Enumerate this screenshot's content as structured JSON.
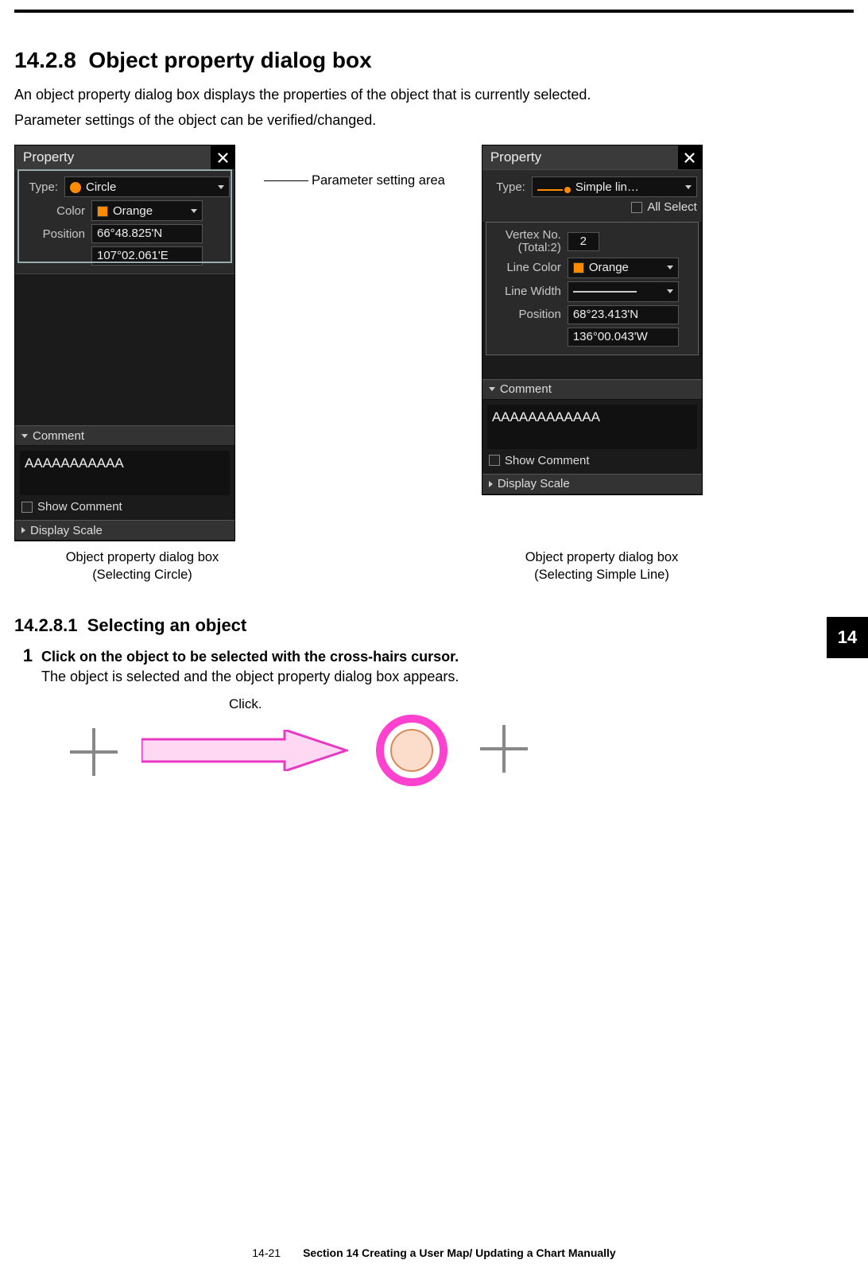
{
  "section": {
    "num": "14.2.8",
    "title": "Object property dialog box",
    "intro1": "An object property dialog box displays the properties of the object that is currently selected.",
    "intro2": "Parameter settings of the object can be verified/changed."
  },
  "callout": {
    "text": "Parameter setting area"
  },
  "dialogA": {
    "title": "Property",
    "typeLabel": "Type:",
    "typeValue": "Circle",
    "colorLabel": "Color",
    "colorValue": "Orange",
    "posLabel": "Position",
    "pos1": "66°48.825'N",
    "pos2": "107°02.061'E",
    "commentHeader": "Comment",
    "commentText": "AAAAAAAAAAA",
    "showComment": "Show Comment",
    "displayScale": "Display Scale",
    "caption1": "Object property dialog box",
    "caption2": "(Selecting Circle)"
  },
  "dialogB": {
    "title": "Property",
    "typeLabel": "Type:",
    "typeValue": "Simple lin…",
    "allSelect": "All Select",
    "vertexLabel1": "Vertex No.",
    "vertexLabel2": "(Total:2)",
    "vertexValue": "2",
    "lineColorLabel": "Line Color",
    "lineColorValue": "Orange",
    "lineWidthLabel": "Line Width",
    "posLabel": "Position",
    "pos1": "68°23.413'N",
    "pos2": "136°00.043'W",
    "commentHeader": "Comment",
    "commentText": "AAAAAAAAAAAA",
    "showComment": "Show Comment",
    "displayScale": "Display Scale",
    "caption1": "Object property dialog box",
    "caption2": "(Selecting Simple Line)"
  },
  "subsection": {
    "num": "14.2.8.1",
    "title": "Selecting an object",
    "stepNum": "1",
    "step1": "Click on the object to be selected with the cross-hairs cursor.",
    "step2": "The object is selected and the object property dialog box appears.",
    "clickLabel": "Click."
  },
  "chapter": "14",
  "footer": {
    "page": "14-21",
    "section": "Section 14    Creating a User Map/ Updating a Chart Manually"
  }
}
